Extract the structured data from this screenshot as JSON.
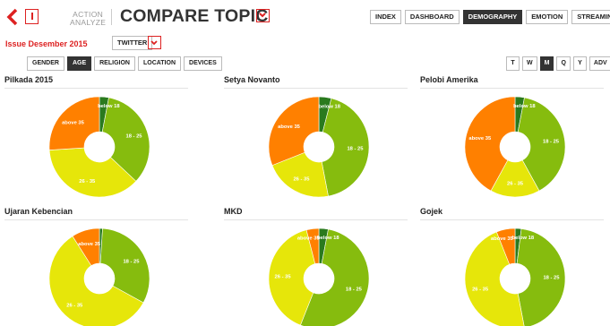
{
  "header": {
    "action_line1": "ACTION",
    "action_line2": "ANALYZE",
    "title": "COMPARE TOPIC",
    "nav": [
      "INDEX",
      "DASHBOARD",
      "DEMOGRAPHY",
      "EMOTION",
      "STREAMING"
    ],
    "nav_active": "DEMOGRAPHY"
  },
  "issue": {
    "label": "Issue Desember 2015",
    "source": "TWITTER"
  },
  "categories": [
    "GENDER",
    "AGE",
    "RELIGION",
    "LOCATION",
    "DEVICES"
  ],
  "category_active": "AGE",
  "periods": [
    "T",
    "W",
    "M",
    "Q",
    "Y",
    "ADV"
  ],
  "period_active": "M",
  "colors": {
    "accent": "#dd2222",
    "below 18": "#2a7a1e",
    "18 - 25": "#86bc0e",
    "26 - 35": "#e6e60a",
    "above 35": "#ff8000"
  },
  "topics": [
    {
      "name": "Pilkada 2015",
      "values": {
        "below 18": 3,
        "18 - 25": 34,
        "26 - 35": 37,
        "above 35": 26
      },
      "labels": {
        "below 18": "below 18",
        "18 - 25": "18 - 25",
        "26 - 35": "26 - 35",
        "above 35": "above 35"
      }
    },
    {
      "name": "Setya Novanto",
      "values": {
        "below 18": 4,
        "18 - 25": 43,
        "26 - 35": 22,
        "above 35": 31
      },
      "labels": {
        "below 18": "below 18",
        "18 - 25": "18 - 25",
        "26 - 35": "26 - 35",
        "above 35": "above 35"
      }
    },
    {
      "name": "Pelobi Amerika",
      "values": {
        "below 18": 3,
        "18 - 25": 39,
        "26 - 35": 16,
        "above 35": 42
      },
      "labels": {
        "below 18": "below 18",
        "18 - 25": "18 - 25",
        "26 - 35": "26 - 35",
        "above 35": "above 35"
      }
    },
    {
      "name": "Ujaran Kebencian",
      "values": {
        "below 18": 1,
        "18 - 25": 32,
        "26 - 35": 58,
        "above 35": 9
      },
      "labels": {
        "below 18": "",
        "18 - 25": "18 - 25",
        "26 - 35": "26 - 35",
        "above 35": "above 35"
      }
    },
    {
      "name": "MKD",
      "values": {
        "below 18": 3,
        "18 - 25": 53,
        "26 - 35": 40,
        "above 35": 4
      },
      "labels": {
        "below 18": "below 18",
        "18 - 25": "18 - 25",
        "26 - 35": "26 - 35",
        "above 35": "above 35"
      }
    },
    {
      "name": "Gojek",
      "values": {
        "below 18": 2,
        "18 - 25": 45,
        "26 - 35": 47,
        "above 35": 6
      },
      "labels": {
        "below 18": "below 18",
        "18 - 25": "18 - 25",
        "26 - 35": "26 - 35",
        "above 35": "above 35"
      }
    }
  ]
}
